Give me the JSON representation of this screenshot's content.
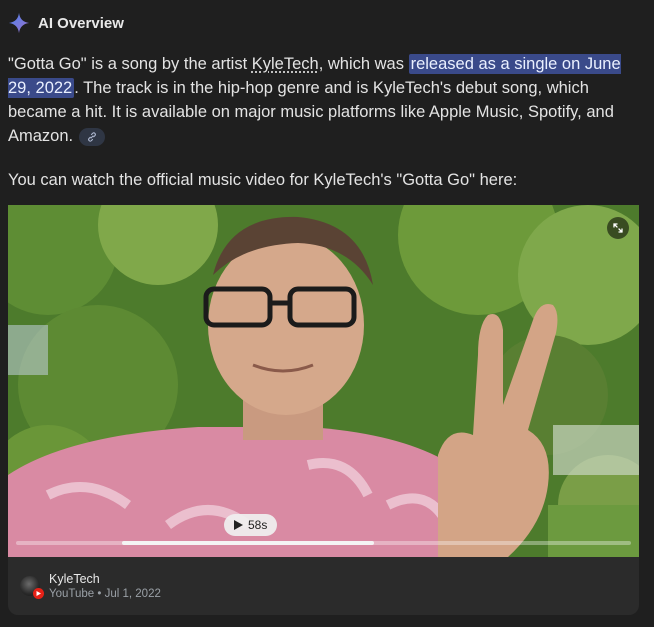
{
  "header": {
    "title": "AI Overview",
    "sparkle_colors": [
      "#4e82ee",
      "#9b72cb"
    ]
  },
  "para1": {
    "lead": "\"Gotta Go\" is a song by the artist ",
    "artist": "KyleTech",
    "mid": ", which was ",
    "highlight": "released as a single on June 29, 2022",
    "tail": ". The track is in the hip-hop genre and is KyleTech's debut song, which became a hit. It is available on major music platforms like Apple Music, Spotify, and Amazon."
  },
  "para2": {
    "text": "You can watch the official music video for KyleTech's \"Gotta Go\" here:"
  },
  "video": {
    "duration": "58s",
    "progress": 0.41,
    "thumbnail": "video-thumbnail"
  },
  "source": {
    "channel": "KyleTech",
    "meta": "YouTube • Jul 1, 2022"
  },
  "colors": {
    "background": "#1f1f1f",
    "highlight": "#3a4a8a",
    "youtube_red": "#e62117"
  }
}
